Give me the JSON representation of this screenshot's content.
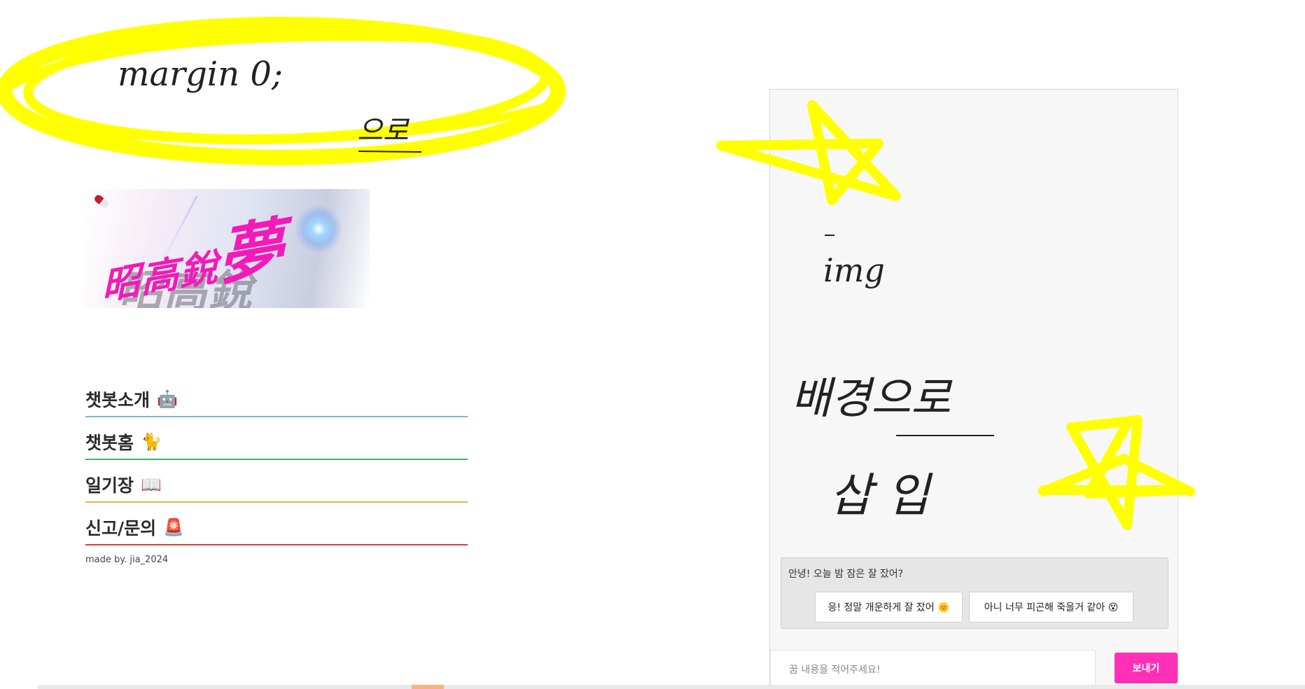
{
  "annotations": {
    "top_note_line1": "margin 0;",
    "top_note_line2": "으로",
    "img_note": "img",
    "bg_note_line1": "배경으로",
    "bg_note_line2": "삽 입",
    "highlight_color": "#ffff00"
  },
  "logo": {
    "main_text": "昭高銳",
    "big_text": "夢",
    "shadow_text": "昭高銳"
  },
  "nav": {
    "items": [
      {
        "label": "챗봇소개",
        "emoji": "🤖"
      },
      {
        "label": "챗봇홈",
        "emoji": "🐈"
      },
      {
        "label": "일기장",
        "emoji": "📖"
      },
      {
        "label": "신고/문의",
        "emoji": "🚨"
      }
    ],
    "underline_colors": [
      "#7fb3dc",
      "#3cb46a",
      "#f0b24a",
      "#e23b3b"
    ]
  },
  "footer": {
    "credit": "made by. jia_2024"
  },
  "chat": {
    "bot_message": "안녕! 오늘 밤 잠은 잘 잤어?",
    "choices": [
      "응! 정말 개운하게 잘 잤어 🌞",
      "아니 너무 피곤해 죽을거 같아 😵"
    ],
    "input_placeholder": "꿈 내용을 적어주세요!",
    "send_label": "보내기",
    "send_color": "#ff2fb7"
  }
}
